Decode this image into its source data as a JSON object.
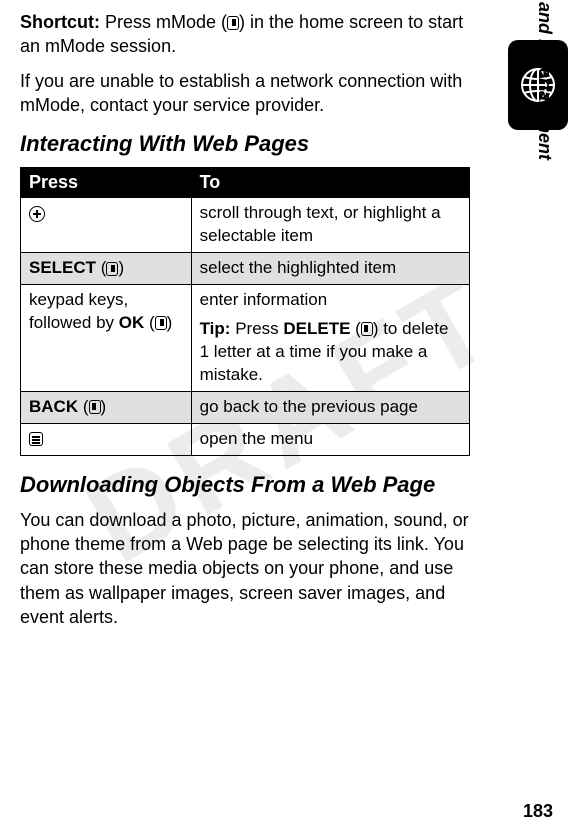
{
  "watermark": "DRAFT",
  "sideLabel": "News and Entertainment",
  "shortcut": {
    "label": "Shortcut:",
    "text1": " Press mMode (",
    "text2": ") in the home screen to start an mMode session."
  },
  "para2": "If you are unable to establish a network connection with mMode, contact your service provider.",
  "heading1": "Interacting With Web Pages",
  "table": {
    "headers": {
      "press": "Press",
      "to": "To"
    },
    "rows": [
      {
        "shaded": false,
        "pressIcon": "nav",
        "pressText": "",
        "to": "scroll through text, or highlight a selectable item"
      },
      {
        "shaded": true,
        "pressIcon": "softkey-right",
        "pressTextCond": "SELECT",
        "pressText": " (",
        "pressText2": ")",
        "to": "select the highlighted item"
      },
      {
        "shaded": false,
        "pressIcon": "softkey-right",
        "pressText1": "keypad keys, followed by ",
        "pressTextCond": "OK",
        "pressText": " (",
        "pressText2": ")",
        "to1": "enter information",
        "tipLabel": "Tip:",
        "tipText1": " Press ",
        "tipCond": "DELETE",
        "tipText2": " (",
        "tipText3": ") to delete 1 letter at a time if you make a mistake."
      },
      {
        "shaded": true,
        "pressIcon": "softkey-left",
        "pressTextCond": "BACK",
        "pressText": " (",
        "pressText2": ")",
        "to": "go back to the previous page"
      },
      {
        "shaded": false,
        "pressIcon": "menu",
        "pressText": "",
        "to": "open the menu"
      }
    ]
  },
  "heading2": "Downloading Objects From a Web Page",
  "para3": "You can download a photo, picture, animation, sound, or phone theme from a Web page be selecting its link. You can store these media objects on your phone, and use them as wallpaper images, screen saver images, and event alerts.",
  "pageNum": "183"
}
